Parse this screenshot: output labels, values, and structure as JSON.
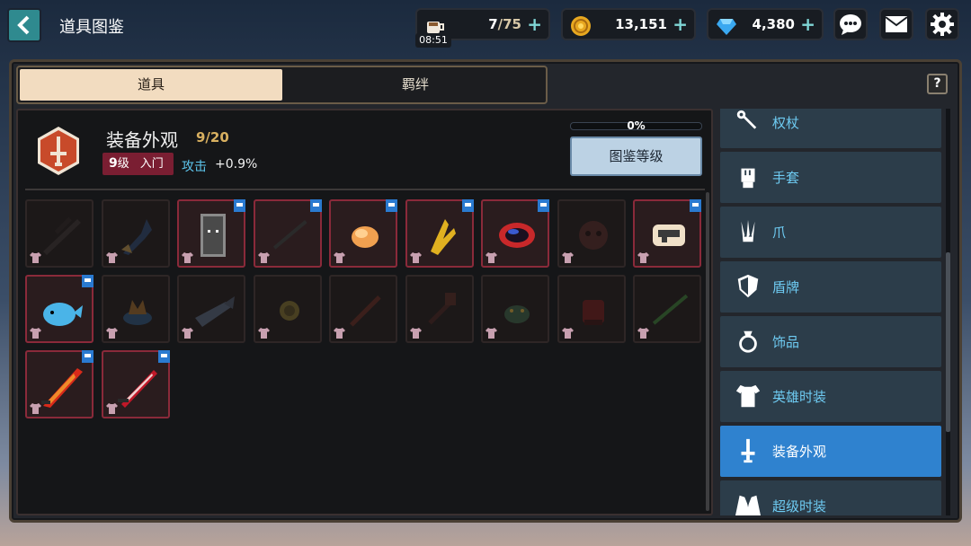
{
  "header": {
    "title": "道具图鉴",
    "energy": {
      "value": "7",
      "max": "/75",
      "timer": "08:51"
    },
    "gold": {
      "value": "13,151"
    },
    "gems": {
      "value": "4,380"
    }
  },
  "tabs": [
    {
      "label": "道具",
      "active": true
    },
    {
      "label": "羁绊",
      "active": false
    }
  ],
  "help_label": "?",
  "category": {
    "title": "装备外观",
    "count": "9/20",
    "level_num": "9",
    "level_unit": "级",
    "rank": "入门",
    "stat_name": "攻击",
    "stat_value": "+0.9%",
    "progress_label": "0%",
    "progress": 0,
    "level_button": "图鉴等级"
  },
  "items": [
    {
      "owned": false,
      "flag": false,
      "art": "dark-crossbow"
    },
    {
      "owned": false,
      "flag": false,
      "art": "blue-wolf-weapon"
    },
    {
      "owned": true,
      "flag": true,
      "art": "stone-shield"
    },
    {
      "owned": true,
      "flag": true,
      "art": "black-staff"
    },
    {
      "owned": true,
      "flag": true,
      "art": "orange-fist"
    },
    {
      "owned": true,
      "flag": true,
      "art": "golden-claw"
    },
    {
      "owned": true,
      "flag": true,
      "art": "dark-ring"
    },
    {
      "owned": false,
      "flag": false,
      "art": "bear-face"
    },
    {
      "owned": true,
      "flag": true,
      "art": "ornate-pistol"
    },
    {
      "owned": true,
      "flag": true,
      "art": "blue-whale"
    },
    {
      "owned": false,
      "flag": false,
      "art": "fox-bowl"
    },
    {
      "owned": false,
      "flag": false,
      "art": "fish"
    },
    {
      "owned": false,
      "flag": false,
      "art": "gold-coin"
    },
    {
      "owned": false,
      "flag": false,
      "art": "red-sword"
    },
    {
      "owned": false,
      "flag": false,
      "art": "red-hammer"
    },
    {
      "owned": false,
      "flag": false,
      "art": "green-creature"
    },
    {
      "owned": false,
      "flag": false,
      "art": "red-gauntlet"
    },
    {
      "owned": false,
      "flag": false,
      "art": "bamboo-staff"
    },
    {
      "owned": true,
      "flag": true,
      "art": "flame-blade"
    },
    {
      "owned": true,
      "flag": true,
      "art": "crimson-sword"
    }
  ],
  "sidebar": {
    "items": [
      {
        "label": "权杖",
        "icon": "scepter-icon",
        "active": false
      },
      {
        "label": "手套",
        "icon": "glove-icon",
        "active": false
      },
      {
        "label": "爪",
        "icon": "claw-icon",
        "active": false
      },
      {
        "label": "盾牌",
        "icon": "shield-icon",
        "active": false
      },
      {
        "label": "饰品",
        "icon": "ring-icon",
        "active": false
      },
      {
        "label": "英雄时装",
        "icon": "shirt-icon",
        "active": false
      },
      {
        "label": "装备外观",
        "icon": "sword-emblem-icon",
        "active": true
      },
      {
        "label": "超级时装",
        "icon": "suit-icon",
        "active": false
      }
    ]
  },
  "colors": {
    "accent_active": "#2f82cf",
    "owned_border": "#8a2a3a",
    "level_badge": "#7a1e32",
    "stat_blue": "#5ec8f0",
    "count_gold": "#d8b060"
  }
}
